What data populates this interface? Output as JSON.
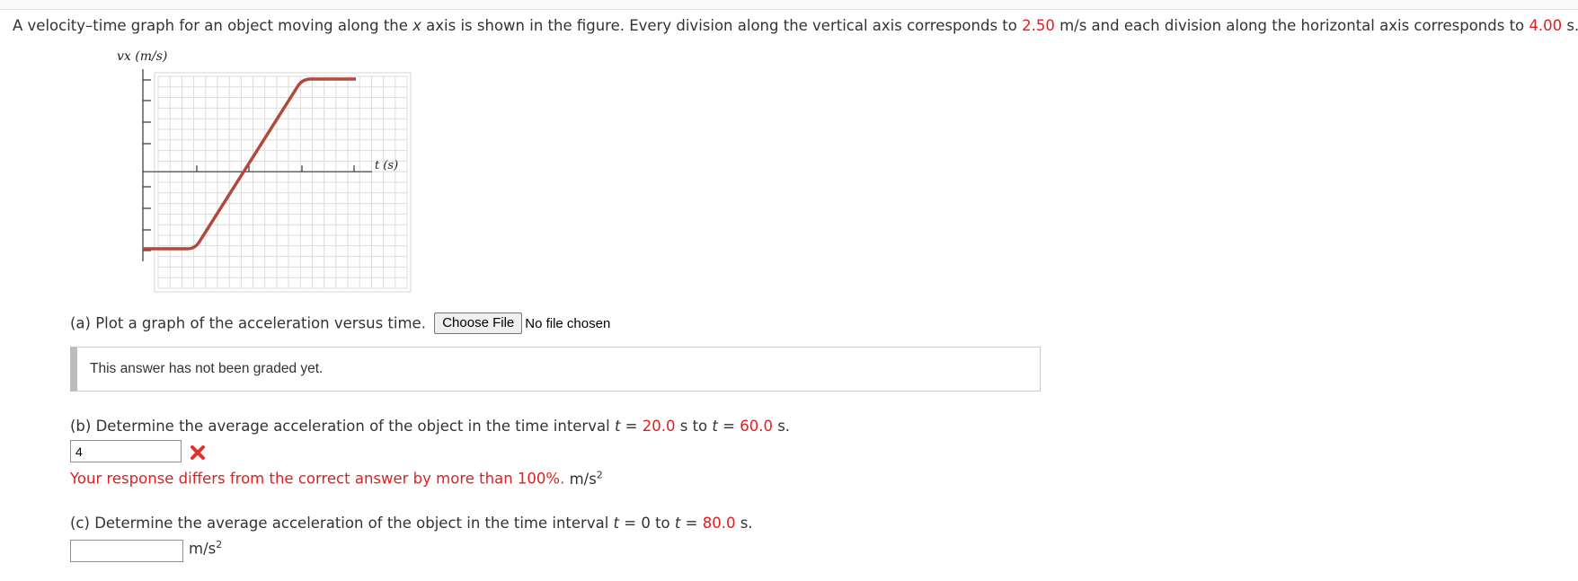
{
  "intro": {
    "p1": "A velocity–time graph for an object moving along the ",
    "var_x": "x",
    "p2": " axis is shown in the figure. Every division along the vertical axis corresponds to ",
    "vdiv": "2.50",
    "p3": " m/s and each division along the horizontal axis corresponds to ",
    "hdiv": "4.00",
    "p4": " s."
  },
  "figure": {
    "y_label": "vx (m/s)",
    "x_label": "t (s)",
    "line_color": "#b14a3c"
  },
  "part_a": {
    "question": "(a) Plot a graph of the acceleration versus time.",
    "file_button": "Choose File",
    "file_status": "No file chosen",
    "graded_message": "This answer has not been graded yet."
  },
  "part_b": {
    "q1": "(b) Determine the average acceleration of the object in the time interval ",
    "t_var": "t",
    "eq1": " = ",
    "t1": "20.0",
    "q2": " s to ",
    "eq2": " = ",
    "t2": "60.0",
    "q3": " s.",
    "answer": "4",
    "feedback": "Your response differs from the correct answer by more than 100%.",
    "unit": "m/s",
    "unit_exp": "2",
    "status_icon": "x-mark-icon",
    "error_color": "#e02020"
  },
  "part_c": {
    "q1": "(c) Determine the average acceleration of the object in the time interval ",
    "t_var": "t",
    "eq1": " = 0 to ",
    "eq2": " = ",
    "t2": "80.0",
    "q3": " s.",
    "answer": "",
    "unit": "m/s",
    "unit_exp": "2"
  }
}
